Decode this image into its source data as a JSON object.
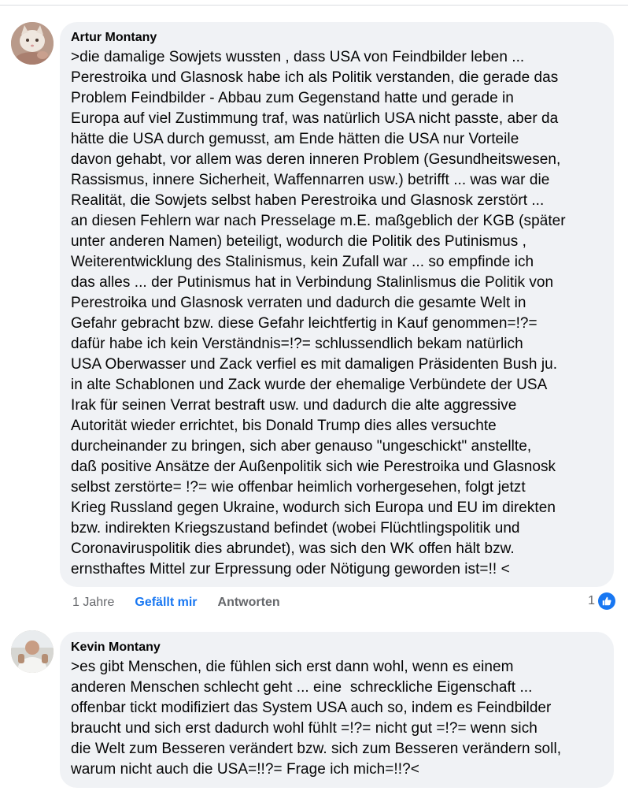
{
  "comments": [
    {
      "author": "Artur Montany",
      "text": ">die damalige Sowjets wussten , dass USA von Feindbilder leben ...\nPerestroika und Glasnosk habe ich als Politik verstanden, die gerade das\nProblem Feindbilder - Abbau zum Gegenstand hatte und gerade in\nEuropa auf viel Zustimmung traf, was natürlich USA nicht passte, aber da\nhätte die USA durch gemusst, am Ende hätten die USA nur Vorteile\ndavon gehabt, vor allem was deren inneren Problem (Gesundheitswesen,\nRassismus, innere Sicherheit, Waffennarren usw.) betrifft ... was war die\nRealität, die Sowjets selbst haben Perestroika und Glasnosk zerstört ...\nan diesen Fehlern war nach Presselage m.E. maßgeblich der KGB (später\nunter anderen Namen) beteiligt, wodurch die Politik des Putinismus ,\nWeiterentwicklung des Stalinismus, kein Zufall war ... so empfinde ich\ndas alles ... der Putinismus hat in Verbindung Stalinlismus die Politik von\nPerestroika und Glasnosk verraten und dadurch die gesamte Welt in\nGefahr gebracht bzw. diese Gefahr leichtfertig in Kauf genommen=!?=\ndafür habe ich kein Verständnis=!?= schlussendlich bekam natürlich\nUSA Oberwasser und Zack verfiel es mit damaligen Präsidenten Bush ju.\nin alte Schablonen und Zack wurde der ehemalige Verbündete der USA\nIrak für seinen Verrat bestraft usw. und dadurch die alte aggressive\nAutorität wieder errichtet, bis Donald Trump dies alles versuchte\ndurcheinander zu bringen, sich aber genauso \"ungeschickt\" anstellte,\ndaß positive Ansätze der Außenpolitik sich wie Perestroika und Glasnosk\nselbst zerstörte= !?= wie offenbar heimlich vorhergesehen, folgt jetzt\nKrieg Russland gegen Ukraine, wodurch sich Europa und EU im direkten\nbzw. indirekten Kriegszustand befindet (wobei Flüchtlingspolitik und\nCoronaviruspolitik dies abrundet), was sich den WK offen hält bzw.\nernsthaftes Mittel zur Erpressung oder Nötigung geworden ist=!! <",
      "time": "1 Jahre",
      "like_label": "Gefällt mir",
      "reply_label": "Antworten",
      "reaction_count": "1",
      "reaction_icon": "thumbs-up-icon"
    },
    {
      "author": "Kevin Montany",
      "text": ">es gibt Menschen, die fühlen sich erst dann wohl, wenn es einem\nanderen Menschen schlecht geht ... eine  schreckliche Eigenschaft ...\noffenbar tickt modifiziert das System USA auch so, indem es Feindbilder\nbraucht und sich erst dadurch wohl fühlt =!?= nicht gut =!?= wenn sich\ndie Welt zum Besseren verändert bzw. sich zum Besseren verändern soll,\nwarum nicht auch die USA=!!?= Frage ich mich=!!?<"
    }
  ],
  "colors": {
    "bubble": "#f0f2f5",
    "link": "#1877f2",
    "meta": "#65676b"
  }
}
